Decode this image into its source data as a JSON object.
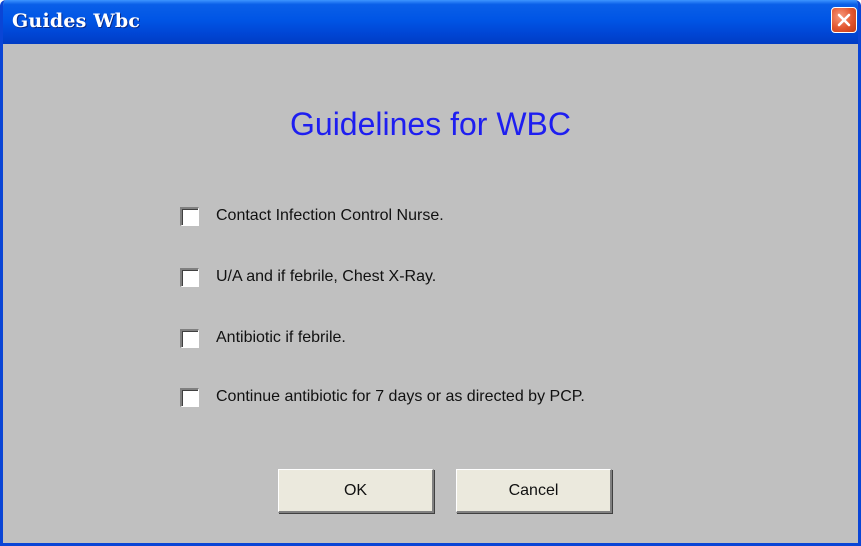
{
  "window": {
    "title": "Guides Wbc",
    "close_icon": "close-icon"
  },
  "dialog": {
    "heading": "Guidelines for WBC",
    "heading_color": "#1e1ef0",
    "items": [
      {
        "label": "Contact Infection Control Nurse.",
        "checked": false
      },
      {
        "label": "U/A and if febrile, Chest X-Ray.",
        "checked": false
      },
      {
        "label": "Antibiotic if febrile.",
        "checked": false
      },
      {
        "label": "Continue antibiotic for 7 days or as directed by PCP.",
        "checked": false
      }
    ],
    "buttons": {
      "ok_label": "OK",
      "cancel_label": "Cancel"
    }
  },
  "colors": {
    "titlebar": "#0055e5",
    "close_button": "#e2552f",
    "dialog_background": "#c0c0c0",
    "button_face": "#ebe9dd"
  }
}
